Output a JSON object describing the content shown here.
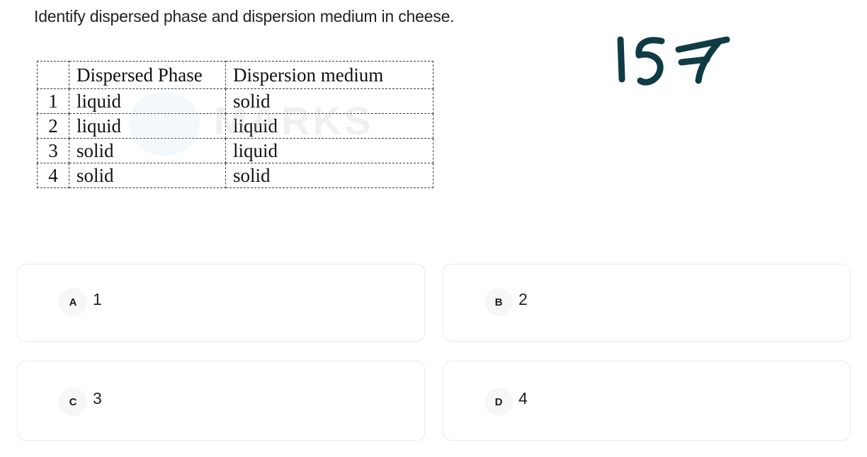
{
  "question": {
    "text": "Identify dispersed phase and dispersion medium in cheese."
  },
  "annotation": {
    "handwritten_number": "157",
    "ink_color": "#0f3b44"
  },
  "table": {
    "headers": [
      "",
      "Dispersed Phase",
      "Dispersion medium"
    ],
    "rows": [
      [
        "1",
        "liquid",
        "solid"
      ],
      [
        "2",
        "liquid",
        "liquid"
      ],
      [
        "3",
        "solid",
        "liquid"
      ],
      [
        "4",
        "solid",
        "solid"
      ]
    ],
    "watermark": "MARKS"
  },
  "options": [
    {
      "letter": "A",
      "value": "1"
    },
    {
      "letter": "B",
      "value": "2"
    },
    {
      "letter": "C",
      "value": "3"
    },
    {
      "letter": "D",
      "value": "4"
    }
  ]
}
